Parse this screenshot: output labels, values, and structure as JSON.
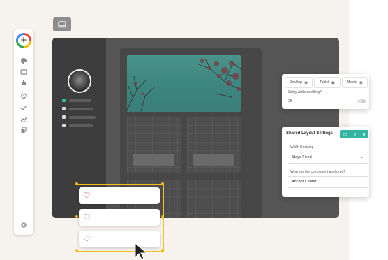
{
  "colors": {
    "accent": "#34b5a1",
    "selection": "#f2bd1d",
    "heart": "#b84a66"
  },
  "toolbar": {
    "icons": [
      "add-icon",
      "palette-icon",
      "layout-icon",
      "sync-icon",
      "settings-icon",
      "check-icon",
      "analytics-icon",
      "copy-icon",
      "help-icon"
    ]
  },
  "responsive_panel": {
    "tabs": [
      {
        "label": "Desktop",
        "icon": "eye-icon"
      },
      {
        "label": "Tablet",
        "icon": "eye-icon"
      },
      {
        "label": "Mobile",
        "icon": "eye-icon"
      }
    ],
    "sticky_label": "Sticky while scrolling?",
    "toggle_value": "Off"
  },
  "layout_panel": {
    "title": "Shared Layout Settings",
    "width_label": "Width Resizing",
    "width_value": "Stays Fixed",
    "anchor_label": "Where is the component anchored?",
    "anchor_value": "Anchor Center"
  },
  "heart_cards": [
    {
      "icon": "heart-icon"
    },
    {
      "icon": "heart-icon"
    },
    {
      "icon": "heart-icon"
    }
  ]
}
